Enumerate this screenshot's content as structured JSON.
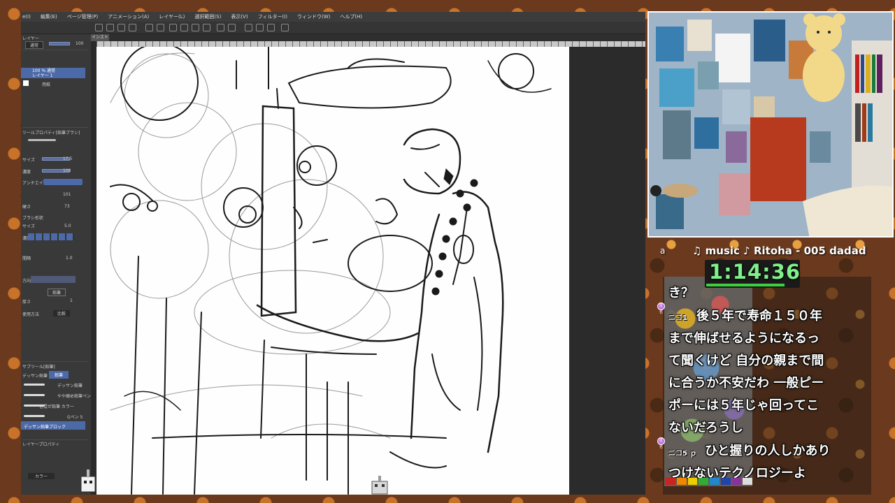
{
  "menu": {
    "items": [
      "e(I)",
      "編集(E)",
      "ページ管理(P)",
      "アニメーション(A)",
      "レイヤー(L)",
      "選択範囲(S)",
      "表示(V)",
      "フィルター(I)",
      "ウィンドウ(W)",
      "ヘルプ(H)"
    ]
  },
  "panel": {
    "layer_header": "レイヤー",
    "blend_mode": "通常",
    "opacity_value": "100",
    "layer_name": "100 % 通常\nレイヤー 1",
    "paper_layer": "用紙",
    "tool_property_header": "ツールプロパティ[鉛筆ブラシ]",
    "brush_size_label": "サイズ",
    "brush_size_value": "17.5",
    "density_label": "濃度",
    "density_value": "100",
    "antialias_label": "アンチエイリアス",
    "hardness_label": "硬さ",
    "value_101": "101",
    "value_73": "73",
    "brush_shape_label": "ブラシ形状",
    "size_label_2": "サイズ",
    "size_value_2": "5.0",
    "density_label_2": "濃度",
    "interval_label": "間隔",
    "interval_value": "1.0",
    "direction_label": "方向",
    "pencil_label": "鉛筆",
    "thickness_label": "厚さ",
    "thickness_value": "1",
    "usage_label": "使用方法",
    "usage_value": "比較",
    "subtool_header": "サブツール[鉛筆]",
    "subtool_tab1": "デッサン鉛筆",
    "subtool_tab2": "鉛筆",
    "brush_items": [
      "デッサン鉛筆",
      "やや硬め鉛筆ペン",
      "色混ぜ鉛筆 カラー",
      "Gペン 5",
      "デッサン鉛筆ブロック"
    ],
    "layer_property": "レイヤープロパティ",
    "color_label": "カラー",
    "doc_tab": "インスト*"
  },
  "overlay": {
    "a_label": "a",
    "music": "♫ music ♪ Ritoha - 005 dadad",
    "timer": "1:14:36",
    "chat_lines": [
      "き？",
      "後５年で寿命１５０年",
      "まで伸ばせるようになるっ",
      "て聞くけど 自分の親まで間",
      "に合うか不安だわ 一般ピー",
      "ポーには５年じゃ回ってこ",
      "ないだろうし",
      "ひと握りの人しかあり",
      "つけないテクノロジーよ"
    ],
    "chat_user1": "ニコ1",
    "chat_user2": "ニコ5 ｐ",
    "badge_label": "匿名"
  },
  "colors": {
    "accent": "#4d6aa8",
    "timer_color": "#7ff08a",
    "badge": "#c26be0",
    "palette": [
      "#cc2222",
      "#ee8800",
      "#eecc00",
      "#33aa33",
      "#2288cc",
      "#2244aa",
      "#883399",
      "#dddddd"
    ]
  }
}
